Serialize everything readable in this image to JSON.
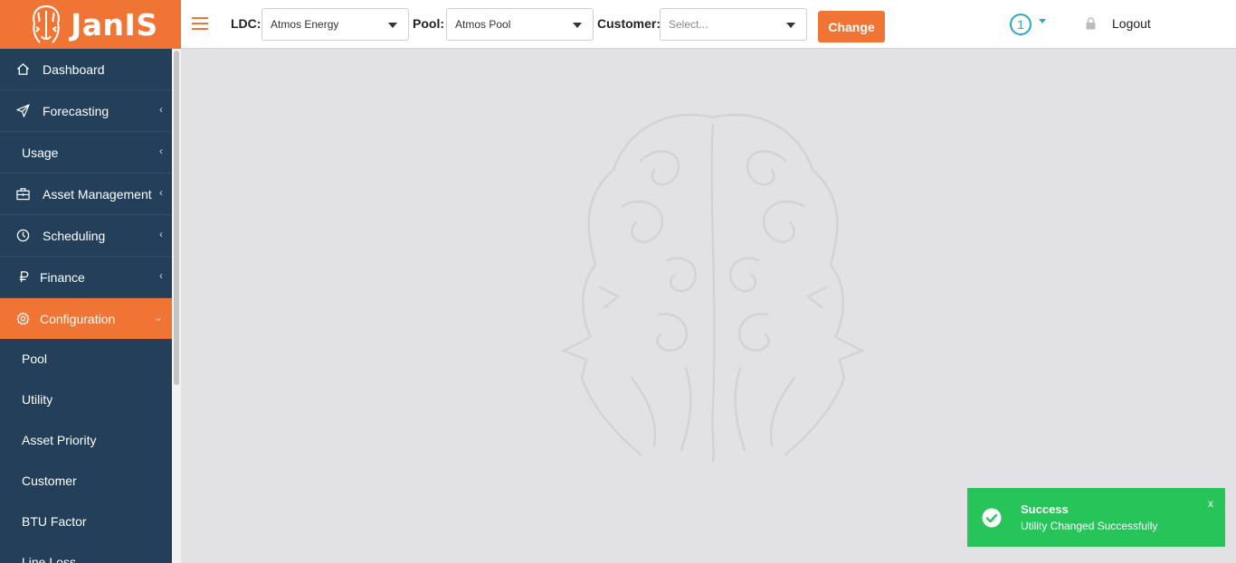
{
  "brand": {
    "name": "JanIS"
  },
  "header": {
    "ldc_label": "LDC:",
    "ldc_value": "Atmos Energy",
    "pool_label": "Pool:",
    "pool_value": "Atmos Pool",
    "customer_label": "Customer:",
    "customer_placeholder": "Select...",
    "change_label": "Change",
    "notification_count": "1",
    "logout_label": "Logout"
  },
  "sidebar": {
    "items": [
      {
        "label": "Dashboard",
        "icon": "home-icon",
        "chevron": ""
      },
      {
        "label": "Forecasting",
        "icon": "paper-plane-icon",
        "chevron": "‹"
      },
      {
        "label": "Usage",
        "icon": "",
        "chevron": "‹"
      },
      {
        "label": "Asset Management",
        "icon": "briefcase-icon",
        "chevron": "‹"
      },
      {
        "label": "Scheduling",
        "icon": "clock-icon",
        "chevron": "‹"
      },
      {
        "label": "Finance",
        "icon": "ruble-icon",
        "chevron": "‹"
      },
      {
        "label": "Configuration",
        "icon": "gear-icon",
        "chevron": "⌄"
      }
    ],
    "sub_items": [
      "Pool",
      "Utility",
      "Asset Priority",
      "Customer",
      "BTU Factor",
      "Line Loss"
    ]
  },
  "toast": {
    "title": "Success",
    "message": "Utility Changed Successfully",
    "close": "x"
  },
  "colors": {
    "accent": "#f07535",
    "sidebar": "#233f5a",
    "success": "#27c45a",
    "info": "#2aa7c9"
  }
}
